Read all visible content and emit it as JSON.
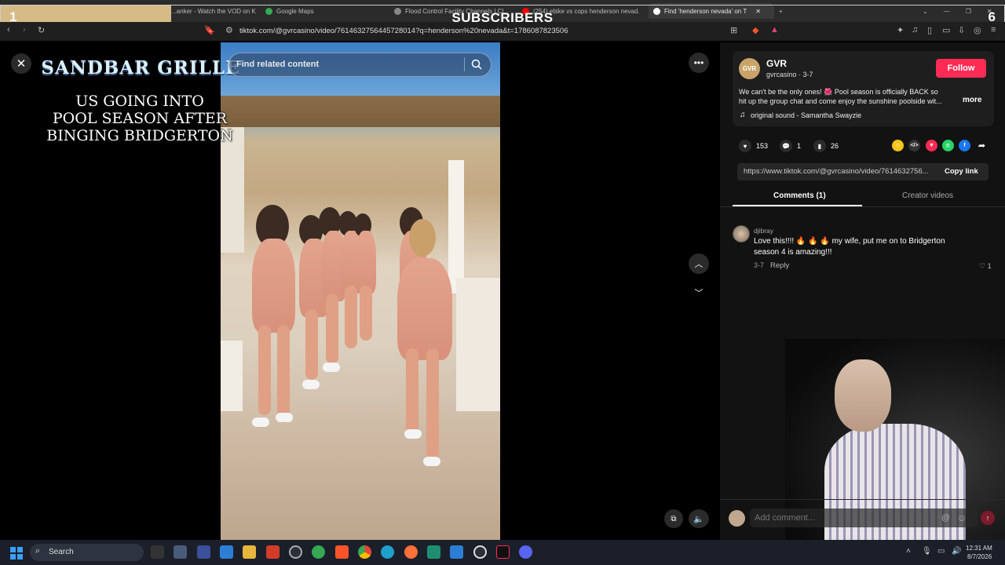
{
  "overlay": {
    "left_count": "1",
    "right_count": "6",
    "title": "SUBSCRIBERS",
    "progress_fraction": 0.17
  },
  "browser": {
    "tabs": [
      {
        "label": "...anker - Watch the VOD on K",
        "color": "#53fc18"
      },
      {
        "label": "Google Maps",
        "color": "#34a853"
      },
      {
        "label": "Flood Control Facility Channels | Cl...",
        "color": "#888888"
      },
      {
        "label": "(254) ebike vs cops henderson nevad...",
        "color": "#ff0000"
      },
      {
        "label": "Find 'henderson nevada' on T",
        "color": "#ffffff"
      }
    ],
    "new_tab": "+",
    "url": "tiktok.com/@gvrcasino/video/7614632756445728014?q=henderson%20nevada&t=1786087823506"
  },
  "video": {
    "search_placeholder": "Find related content",
    "sign": "SANDBAR GRILLE",
    "caption_lines": [
      "US GOING INTO",
      "POOL SEASON AFTER",
      "BINGING BRIDGERTON"
    ]
  },
  "post": {
    "avatar_text": "GVR",
    "author": "GVR",
    "handle": "gvrcasino · 3-7",
    "follow": "Follow",
    "desc_line1": "We can't be the only ones! 🌺 Pool season is officially BACK so",
    "desc_line2": "hit up the group chat and come enjoy the sunshine poolside wit...",
    "more": "more",
    "sound": "original sound - Samantha Swayzie",
    "likes": "153",
    "comments": "1",
    "saves": "26",
    "link": "https://www.tiktok.com/@gvrcasino/video/7614632756...",
    "copy_link": "Copy link",
    "tabs": {
      "comments": "Comments (1)",
      "creator": "Creator videos"
    }
  },
  "comment": {
    "user": "djibray",
    "text1": "Love this!!!! 🔥 🔥 🔥 my wife, put me on to Bridgerton",
    "text2": "season 4 is amazing!!!",
    "date": "3-7",
    "reply": "Reply",
    "likes": "1"
  },
  "composer": {
    "placeholder": "Add comment..."
  },
  "taskbar": {
    "search_label": "Search",
    "time": "12:31 AM",
    "date": "8/7/2026"
  }
}
